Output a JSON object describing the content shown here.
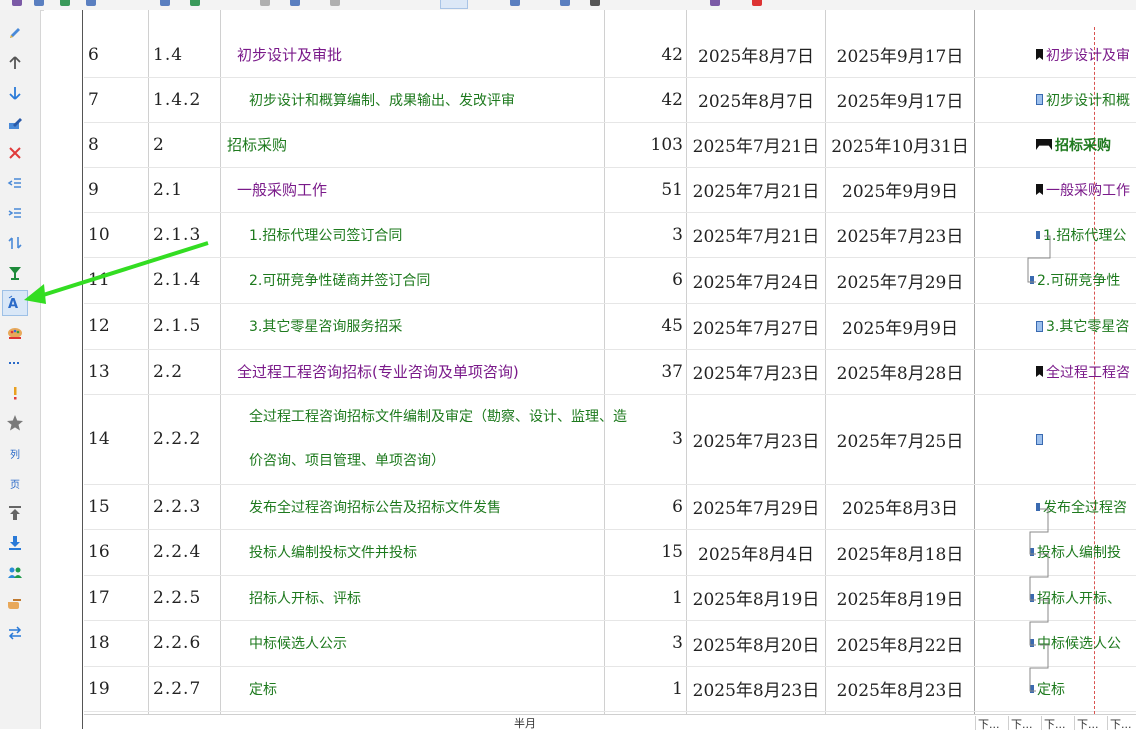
{
  "colors": {
    "summary_text": "#1e7a1e",
    "group_text": "#7a1a8a",
    "task_text": "#1e7a1e",
    "annotation_arrow": "#33dd22",
    "today_line": "#d9534f",
    "sidebar_bg": "#f2f2f2"
  },
  "sidebar": {
    "items": [
      {
        "icon": "pencil-icon"
      },
      {
        "icon": "arrow-up-icon"
      },
      {
        "icon": "arrow-down-icon"
      },
      {
        "icon": "edit-note-icon"
      },
      {
        "icon": "delete-icon"
      },
      {
        "icon": "outdent-icon"
      },
      {
        "icon": "indent-icon"
      },
      {
        "icon": "sort-icon"
      },
      {
        "icon": "filter-icon"
      },
      {
        "icon": "font-icon"
      },
      {
        "icon": "palette-icon"
      },
      {
        "icon": "dotted-line-icon"
      },
      {
        "icon": "exclamation-icon"
      },
      {
        "icon": "star-icon"
      },
      {
        "icon": "column-icon",
        "label": "列"
      },
      {
        "icon": "page-icon",
        "label": "页"
      },
      {
        "icon": "move-top-icon"
      },
      {
        "icon": "download-icon"
      },
      {
        "icon": "users-icon"
      },
      {
        "icon": "hand-point-icon"
      },
      {
        "icon": "swap-icon"
      }
    ]
  },
  "rows": [
    {
      "id": "6",
      "wbs": "1.4",
      "name": "初步设计及审批",
      "level": 1,
      "duration": "42",
      "start": "2025年8月7日",
      "end": "2025年9月17日",
      "bar_label": "初步设计及审",
      "marker": "flag"
    },
    {
      "id": "7",
      "wbs": "1.4.2",
      "name": "初步设计和概算编制、成果输出、发改评审",
      "level": 2,
      "duration": "42",
      "start": "2025年8月7日",
      "end": "2025年9月17日",
      "bar_label": "初步设计和概",
      "marker": "task"
    },
    {
      "id": "8",
      "wbs": "2",
      "name": "招标采购",
      "level": 0,
      "duration": "103",
      "start": "2025年7月21日",
      "end": "2025年10月31日",
      "bar_label": "招标采购",
      "marker": "bigflag"
    },
    {
      "id": "9",
      "wbs": "2.1",
      "name": "一般采购工作",
      "level": 1,
      "duration": "51",
      "start": "2025年7月21日",
      "end": "2025年9月9日",
      "bar_label": "一般采购工作",
      "marker": "flag"
    },
    {
      "id": "10",
      "wbs": "2.1.3",
      "name": "1.招标代理公司签订合同",
      "level": 2,
      "duration": "3",
      "start": "2025年7月21日",
      "end": "2025年7月23日",
      "bar_label": "1.招标代理公",
      "marker": "ms"
    },
    {
      "id": "11",
      "wbs": "2.1.4",
      "name": "2.可研竞争性磋商并签订合同",
      "level": 2,
      "duration": "6",
      "start": "2025年7月24日",
      "end": "2025年7月29日",
      "bar_label": "2.可研竞争性",
      "marker": "link"
    },
    {
      "id": "12",
      "wbs": "2.1.5",
      "name": "3.其它零星咨询服务招采",
      "level": 2,
      "duration": "45",
      "start": "2025年7月27日",
      "end": "2025年9月9日",
      "bar_label": "3.其它零星咨",
      "marker": "task"
    },
    {
      "id": "13",
      "wbs": "2.2",
      "name": "全过程工程咨询招标(专业咨询及单项咨询)",
      "level": 1,
      "duration": "37",
      "start": "2025年7月23日",
      "end": "2025年8月28日",
      "bar_label": "全过程工程咨",
      "marker": "flag"
    },
    {
      "id": "14",
      "wbs": "2.2.2",
      "name": "全过程工程咨询招标文件编制及审定（勘察、设计、监理、造价咨询、项目管理、单项咨询）",
      "level": 2,
      "duration": "3",
      "start": "2025年7月23日",
      "end": "2025年7月25日",
      "bar_label": "",
      "marker": "task"
    },
    {
      "id": "15",
      "wbs": "2.2.3",
      "name": "发布全过程咨询招标公告及招标文件发售",
      "level": 2,
      "duration": "6",
      "start": "2025年7月29日",
      "end": "2025年8月3日",
      "bar_label": "发布全过程咨",
      "marker": "ms"
    },
    {
      "id": "16",
      "wbs": "2.2.4",
      "name": "投标人编制投标文件并投标",
      "level": 2,
      "duration": "15",
      "start": "2025年8月4日",
      "end": "2025年8月18日",
      "bar_label": "投标人编制投",
      "marker": "link"
    },
    {
      "id": "17",
      "wbs": "2.2.5",
      "name": "招标人开标、评标",
      "level": 2,
      "duration": "1",
      "start": "2025年8月19日",
      "end": "2025年8月19日",
      "bar_label": "招标人开标、",
      "marker": "link"
    },
    {
      "id": "18",
      "wbs": "2.2.6",
      "name": "中标候选人公示",
      "level": 2,
      "duration": "3",
      "start": "2025年8月20日",
      "end": "2025年8月22日",
      "bar_label": "中标候选人公",
      "marker": "link"
    },
    {
      "id": "19",
      "wbs": "2.2.7",
      "name": "定标",
      "level": 2,
      "duration": "1",
      "start": "2025年8月23日",
      "end": "2025年8月23日",
      "bar_label": "定标",
      "marker": "link"
    }
  ],
  "footer": {
    "scale_label": "半月",
    "ticks": [
      "下...",
      "下...",
      "下...",
      "下...",
      "下..."
    ]
  }
}
